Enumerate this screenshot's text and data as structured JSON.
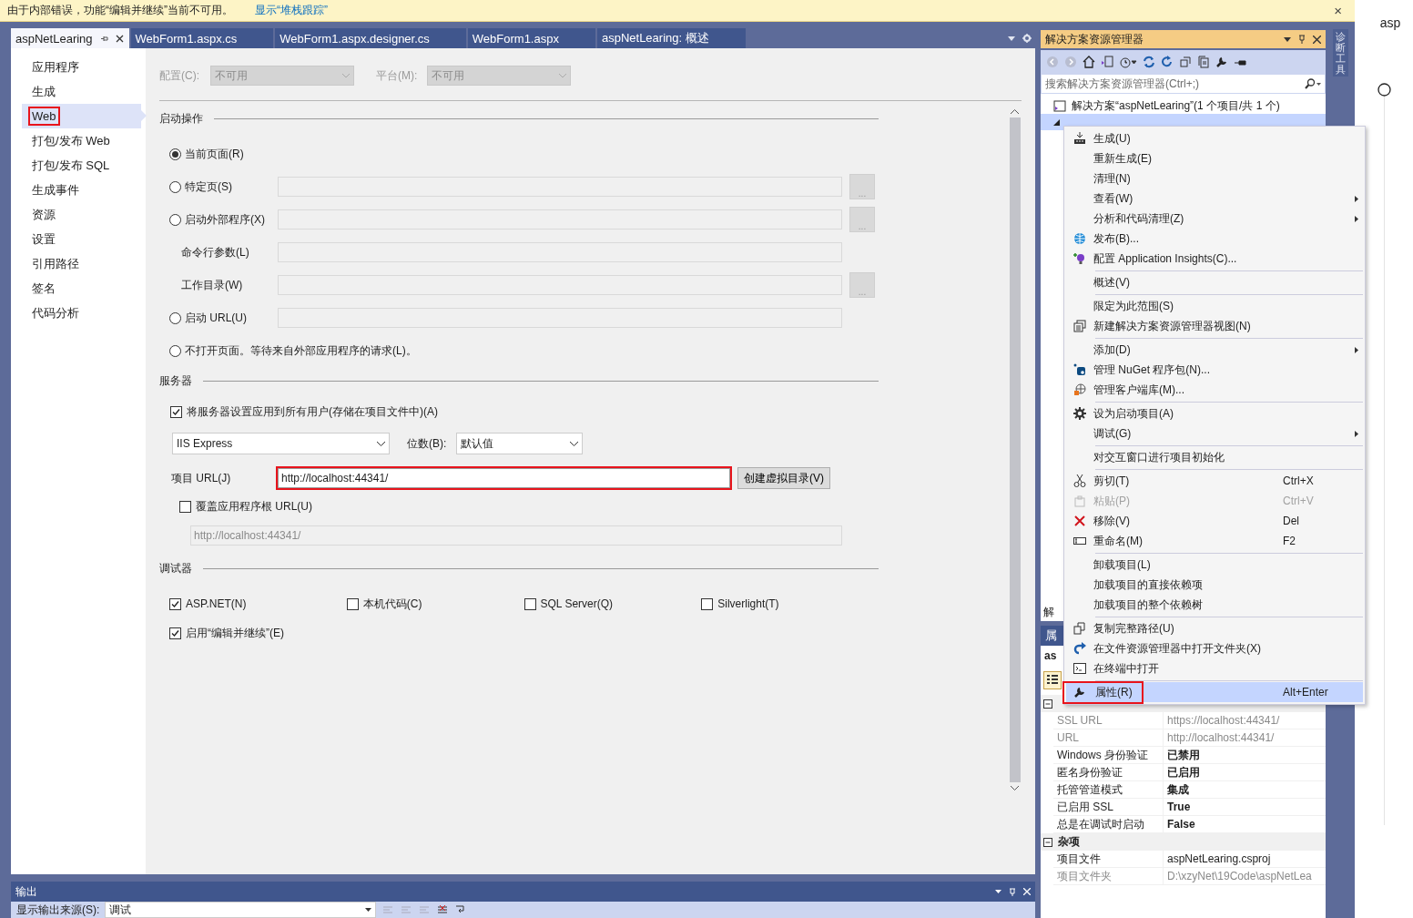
{
  "infobar": {
    "message": "由于内部错误，功能“编辑并继续”当前不可用。",
    "link": "显示“堆栈跟踪”",
    "close": "×"
  },
  "tabs": [
    {
      "label": "aspNetLearing",
      "selected": true
    },
    {
      "label": "WebForm1.aspx.cs",
      "selected": false
    },
    {
      "label": "WebForm1.aspx.designer.cs",
      "selected": false
    },
    {
      "label": "WebForm1.aspx",
      "selected": false
    },
    {
      "label": "aspNetLearing: 概述",
      "selected": false
    }
  ],
  "nav": [
    {
      "label": "应用程序",
      "selected": false,
      "marked": false
    },
    {
      "label": "生成",
      "selected": false,
      "marked": false
    },
    {
      "label": "Web",
      "selected": true,
      "marked": true
    },
    {
      "label": "打包/发布 Web",
      "selected": false,
      "marked": false
    },
    {
      "label": "打包/发布 SQL",
      "selected": false,
      "marked": false
    },
    {
      "label": "生成事件",
      "selected": false,
      "marked": false
    },
    {
      "label": "资源",
      "selected": false,
      "marked": false
    },
    {
      "label": "设置",
      "selected": false,
      "marked": false
    },
    {
      "label": "引用路径",
      "selected": false,
      "marked": false
    },
    {
      "label": "签名",
      "selected": false,
      "marked": false
    },
    {
      "label": "代码分析",
      "selected": false,
      "marked": false
    }
  ],
  "config_bar": [
    {
      "label": "配置(C):",
      "value": "不可用",
      "disabled": true
    },
    {
      "label": "平台(M):",
      "value": "不可用",
      "disabled": true
    }
  ],
  "start_action": {
    "title": "启动操作",
    "options": [
      {
        "kind": "radio",
        "label": "当前页面(R)",
        "selected": true,
        "input": false
      },
      {
        "kind": "radio",
        "label": "特定页(S)",
        "selected": false,
        "input": true,
        "browse": "..."
      },
      {
        "kind": "radio",
        "label": "启动外部程序(X)",
        "selected": false,
        "input": true,
        "browse": "..."
      },
      {
        "kind": "label",
        "label": "命令行参数(L)",
        "input": true
      },
      {
        "kind": "label",
        "label": "工作目录(W)",
        "input": true,
        "browse": "..."
      },
      {
        "kind": "radio",
        "label": "启动 URL(U)",
        "selected": false,
        "input": true
      },
      {
        "kind": "radio",
        "label": "不打开页面。等待来自外部应用程序的请求(L)。",
        "selected": false,
        "input": false
      }
    ]
  },
  "server": {
    "title": "服务器",
    "apply_all": {
      "label": "将服务器设置应用到所有用户(存储在项目文件中)(A)",
      "checked": true
    },
    "server_type": "IIS Express",
    "bitness": {
      "label": "位数(B):",
      "value": "默认值"
    },
    "project_url": {
      "label": "项目 URL(J)",
      "value": "http://localhost:44341/",
      "marked": true
    },
    "create_button": "创建虚拟目录(V)",
    "override": {
      "label": "覆盖应用程序根 URL(U)",
      "checked": false
    },
    "override_url": {
      "value": "http://localhost:44341/",
      "disabled": true
    }
  },
  "debuggers": {
    "title": "调试器",
    "options": [
      {
        "label": "ASP.NET(N)",
        "checked": true
      },
      {
        "label": "本机代码(C)",
        "checked": false
      },
      {
        "label": "SQL Server(Q)",
        "checked": false
      },
      {
        "label": "Silverlight(T)",
        "checked": false
      }
    ],
    "edit_continue": {
      "label": "启用“编辑并继续”(E)",
      "checked": true
    }
  },
  "output": {
    "title": "输出",
    "source_label": "显示输出来源(S):",
    "source": "调试"
  },
  "solution_explorer": {
    "title": "解决方案资源管理器",
    "search": {
      "placeholder": "搜索解决方案资源管理器(Ctrl+;)"
    },
    "tree": [
      {
        "label": "解决方案“aspNetLearing”(1 个项目/共 1 个)",
        "selected": false,
        "children": [
          {
            "selected": true,
            "expanded": true
          }
        ]
      }
    ],
    "bottom_tab": "解"
  },
  "context_menu": [
    {
      "kind": "item",
      "label": "生成(U)",
      "selected": false,
      "disabled": false,
      "submenu": false,
      "marked": false
    },
    {
      "kind": "item",
      "label": "重新生成(E)",
      "selected": false,
      "disabled": false,
      "submenu": false,
      "marked": false
    },
    {
      "kind": "item",
      "label": "清理(N)",
      "selected": false,
      "disabled": false,
      "submenu": false,
      "marked": false
    },
    {
      "kind": "item",
      "label": "查看(W)",
      "selected": false,
      "disabled": false,
      "submenu": true,
      "marked": false
    },
    {
      "kind": "item",
      "label": "分析和代码清理(Z)",
      "selected": false,
      "disabled": false,
      "submenu": true,
      "marked": false
    },
    {
      "kind": "item",
      "label": "发布(B)...",
      "selected": false,
      "disabled": false,
      "submenu": false,
      "marked": false
    },
    {
      "kind": "item",
      "label": "配置 Application Insights(C)...",
      "selected": false,
      "disabled": false,
      "submenu": false,
      "marked": false
    },
    {
      "kind": "separator"
    },
    {
      "kind": "item",
      "label": "概述(V)",
      "selected": false,
      "disabled": false,
      "submenu": false,
      "marked": false
    },
    {
      "kind": "separator"
    },
    {
      "kind": "item",
      "label": "限定为此范围(S)",
      "selected": false,
      "disabled": false,
      "submenu": false,
      "marked": false
    },
    {
      "kind": "item",
      "label": "新建解决方案资源管理器视图(N)",
      "selected": false,
      "disabled": false,
      "submenu": false,
      "marked": false
    },
    {
      "kind": "separator"
    },
    {
      "kind": "item",
      "label": "添加(D)",
      "selected": false,
      "disabled": false,
      "submenu": true,
      "marked": false
    },
    {
      "kind": "item",
      "label": "管理 NuGet 程序包(N)...",
      "selected": false,
      "disabled": false,
      "submenu": false,
      "marked": false
    },
    {
      "kind": "item",
      "label": "管理客户端库(M)...",
      "selected": false,
      "disabled": false,
      "submenu": false,
      "marked": false
    },
    {
      "kind": "separator"
    },
    {
      "kind": "item",
      "label": "设为启动项目(A)",
      "selected": false,
      "disabled": false,
      "submenu": false,
      "marked": false
    },
    {
      "kind": "item",
      "label": "调试(G)",
      "selected": false,
      "disabled": false,
      "submenu": true,
      "marked": false
    },
    {
      "kind": "separator"
    },
    {
      "kind": "item",
      "label": "对交互窗口进行项目初始化",
      "selected": false,
      "disabled": false,
      "submenu": false,
      "marked": false
    },
    {
      "kind": "separator"
    },
    {
      "kind": "item",
      "label": "剪切(T)",
      "shortcut": "Ctrl+X",
      "selected": false,
      "disabled": false,
      "submenu": false,
      "marked": false
    },
    {
      "kind": "item",
      "label": "粘贴(P)",
      "shortcut": "Ctrl+V",
      "selected": false,
      "disabled": true,
      "submenu": false,
      "marked": false
    },
    {
      "kind": "item",
      "label": "移除(V)",
      "shortcut": "Del",
      "selected": false,
      "disabled": false,
      "submenu": false,
      "marked": false
    },
    {
      "kind": "item",
      "label": "重命名(M)",
      "shortcut": "F2",
      "selected": false,
      "disabled": false,
      "submenu": false,
      "marked": false
    },
    {
      "kind": "separator"
    },
    {
      "kind": "item",
      "label": "卸载项目(L)",
      "selected": false,
      "disabled": false,
      "submenu": false,
      "marked": false
    },
    {
      "kind": "item",
      "label": "加载项目的直接依赖项",
      "selected": false,
      "disabled": false,
      "submenu": false,
      "marked": false
    },
    {
      "kind": "item",
      "label": "加载项目的整个依赖树",
      "selected": false,
      "disabled": false,
      "submenu": false,
      "marked": false
    },
    {
      "kind": "separator"
    },
    {
      "kind": "item",
      "label": "复制完整路径(U)",
      "selected": false,
      "disabled": false,
      "submenu": false,
      "marked": false
    },
    {
      "kind": "item",
      "label": "在文件资源管理器中打开文件夹(X)",
      "selected": false,
      "disabled": false,
      "submenu": false,
      "marked": false
    },
    {
      "kind": "item",
      "label": "在终端中打开",
      "selected": false,
      "disabled": false,
      "submenu": false,
      "marked": false
    },
    {
      "kind": "separator"
    },
    {
      "kind": "item",
      "label": "属性(R)",
      "shortcut": "Alt+Enter",
      "selected": true,
      "disabled": false,
      "submenu": false,
      "marked": true
    }
  ],
  "properties": {
    "tab": "属",
    "object": "as",
    "categories": [
      {
        "expanded": true,
        "rows": [
          {
            "name": "SSL URL",
            "value": "https://localhost:44341/",
            "readonly": true,
            "modified": false
          },
          {
            "name": "URL",
            "value": "http://localhost:44341/",
            "readonly": true,
            "modified": false
          },
          {
            "name": "Windows 身份验证",
            "value": "已禁用",
            "readonly": false,
            "modified": true
          },
          {
            "name": "匿名身份验证",
            "value": "已启用",
            "readonly": false,
            "modified": true
          },
          {
            "name": "托管管道模式",
            "value": "集成",
            "readonly": false,
            "modified": true
          },
          {
            "name": "已启用 SSL",
            "value": "True",
            "readonly": false,
            "modified": true
          },
          {
            "name": "总是在调试时启动",
            "value": "False",
            "readonly": false,
            "modified": true
          }
        ]
      },
      {
        "name": "杂项",
        "expanded": true,
        "rows": [
          {
            "name": "项目文件",
            "value": "aspNetLearing.csproj",
            "readonly": false,
            "modified": false
          },
          {
            "name": "项目文件夹",
            "value": "D:\\xzyNet\\19Code\\aspNetLea",
            "readonly": true,
            "modified": false
          }
        ]
      }
    ]
  },
  "side_tab": "诊断工具",
  "background_window": {
    "text": "asp"
  }
}
